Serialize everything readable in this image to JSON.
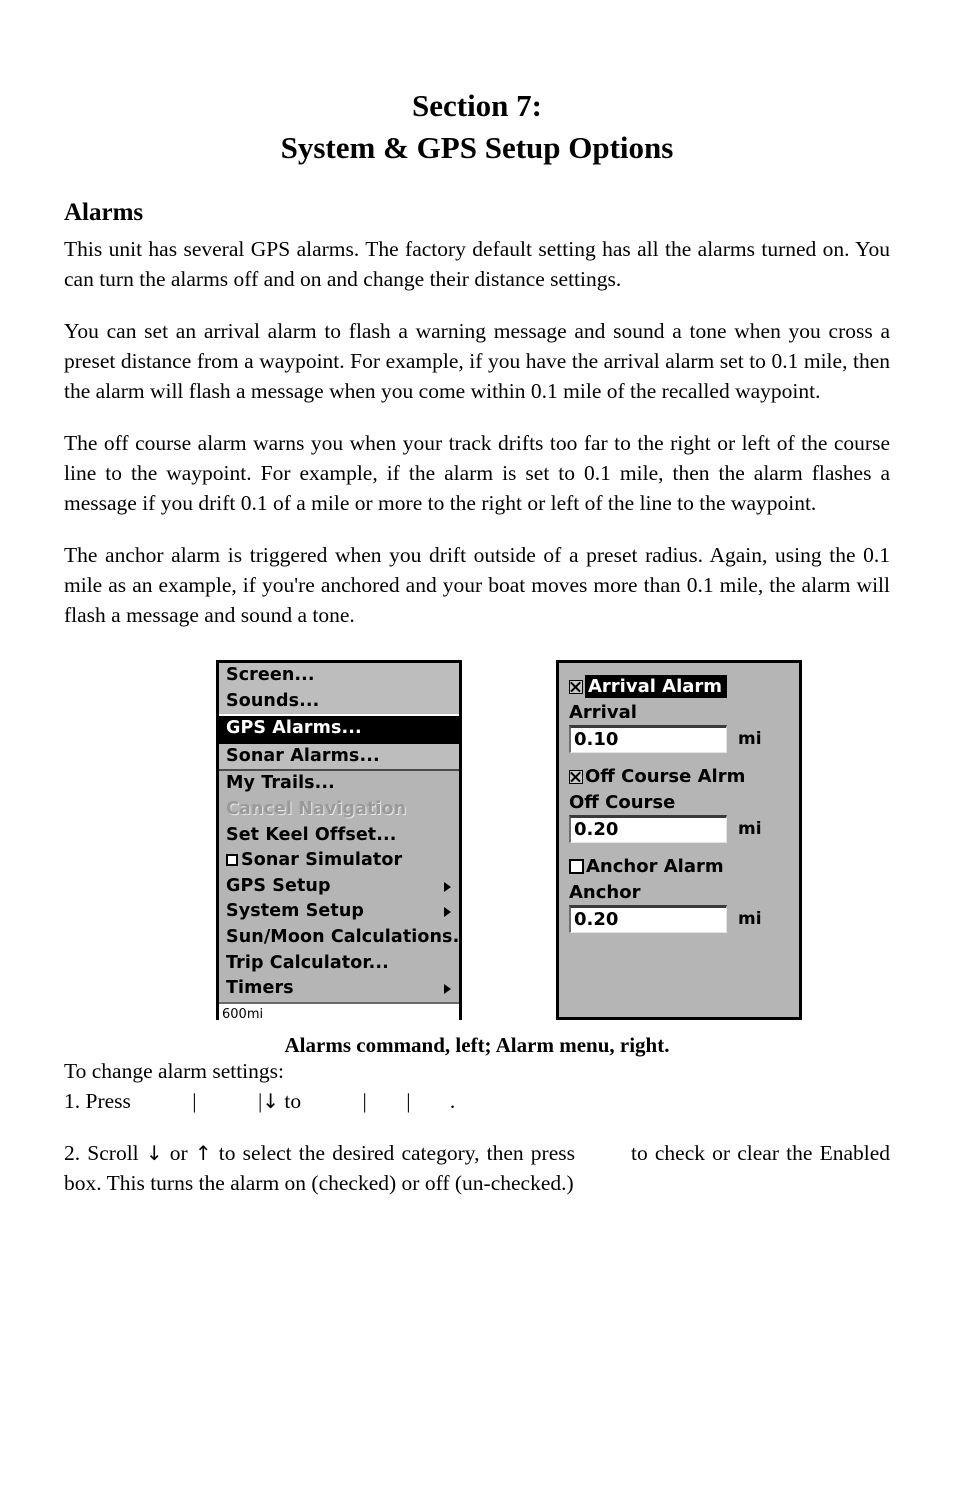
{
  "document": {
    "section_title_line1": "Section 7:",
    "section_title_line2": "System & GPS Setup Options",
    "heading_alarms": "Alarms",
    "paragraph_1": "This unit has several GPS alarms. The factory default setting has all the alarms turned on. You can turn the alarms off and on and change their distance settings.",
    "paragraph_2": "You can set an arrival alarm to flash a warning message and sound a tone when you cross a preset distance from a waypoint. For example, if you have the arrival alarm set to 0.1 mile, then the alarm will flash a message when you come within 0.1 mile of the recalled waypoint.",
    "paragraph_3": "The off course alarm warns you when your track drifts too far to the right or left of the course line to the waypoint. For example, if the alarm is set to 0.1 mile, then the alarm flashes a message if you drift 0.1 of a mile or more to the right or left of the line to the waypoint.",
    "paragraph_4": "The anchor alarm is triggered when you drift outside of a preset radius. Again, using the 0.1 mile as an example, if you're anchored and your boat moves more than 0.1 mile, the alarm will flash a message and sound a tone.",
    "figure_caption": "Alarms command, left; Alarm menu, right.",
    "instructions_intro": "To change alarm settings:",
    "step_1": {
      "prefix": "1. Press",
      "pipe_1": "|",
      "pipe_2": "|",
      "arrow_down": "↓",
      "to_word": "to",
      "pipe_3": "|",
      "pipe_4": "|",
      "period": "."
    },
    "step_2": {
      "lead": "2. Scroll",
      "arrow_down": "↓",
      "or_word": "or",
      "arrow_up": "↑",
      "mid": "to select the desired category, then press",
      "tail": "to check or clear the Enabled box. This turns the alarm on (checked) or off (un-checked.)"
    }
  },
  "menu_screenshot": {
    "group_top": [
      {
        "label": "Screen...",
        "selected": false,
        "checkbox": null,
        "submenu": false,
        "disabled": false
      },
      {
        "label": "Sounds...",
        "selected": false,
        "checkbox": null,
        "submenu": false,
        "disabled": false
      },
      {
        "label": "GPS Alarms...",
        "selected": true,
        "checkbox": null,
        "submenu": false,
        "disabled": false
      },
      {
        "label": "Sonar Alarms...",
        "selected": false,
        "checkbox": null,
        "submenu": false,
        "disabled": false
      }
    ],
    "group_bottom": [
      {
        "label": "My Trails...",
        "selected": false,
        "checkbox": null,
        "submenu": false,
        "disabled": false
      },
      {
        "label": "Cancel Navigation",
        "selected": false,
        "checkbox": null,
        "submenu": false,
        "disabled": true
      },
      {
        "label": "Set Keel Offset...",
        "selected": false,
        "checkbox": null,
        "submenu": false,
        "disabled": false
      },
      {
        "label": "Sonar Simulator",
        "selected": false,
        "checkbox": "unchecked",
        "submenu": false,
        "disabled": false
      },
      {
        "label": "GPS Setup",
        "selected": false,
        "checkbox": null,
        "submenu": true,
        "disabled": false
      },
      {
        "label": "System Setup",
        "selected": false,
        "checkbox": null,
        "submenu": true,
        "disabled": false
      },
      {
        "label": "Sun/Moon Calculations...",
        "selected": false,
        "checkbox": null,
        "submenu": false,
        "disabled": false
      },
      {
        "label": "Trip Calculator...",
        "selected": false,
        "checkbox": null,
        "submenu": false,
        "disabled": false
      },
      {
        "label": "Timers",
        "selected": false,
        "checkbox": null,
        "submenu": true,
        "disabled": false
      }
    ],
    "status_bar": "600mi"
  },
  "alarm_screenshot": {
    "entries": [
      {
        "toggle_label": "Arrival Alarm",
        "toggle_checked": true,
        "highlighted": true,
        "field_label": "Arrival",
        "field_value": "0.10",
        "unit": "mi"
      },
      {
        "toggle_label": "Off Course Alrm",
        "toggle_checked": true,
        "highlighted": false,
        "field_label": "Off Course",
        "field_value": "0.20",
        "unit": "mi"
      },
      {
        "toggle_label": "Anchor Alarm",
        "toggle_checked": false,
        "highlighted": false,
        "field_label": "Anchor",
        "field_value": "0.20",
        "unit": "mi"
      }
    ]
  },
  "colors": {
    "page_background": "#ffffff",
    "text": "#000000",
    "device_panel_gray": "#b5b5b5",
    "device_group_gray": "#bdbdbd",
    "selection_black": "#000000",
    "selection_text": "#ffffff",
    "disabled_text": "#9a9a9a",
    "field_white": "#ffffff"
  }
}
